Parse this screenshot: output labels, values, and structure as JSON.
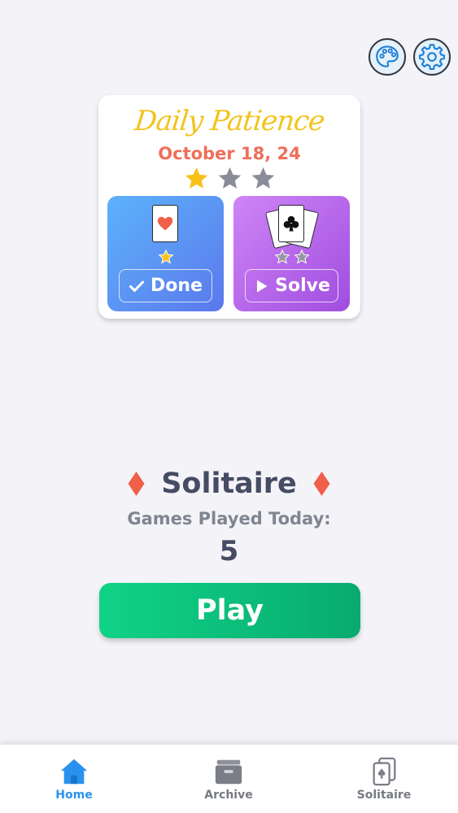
{
  "header": {
    "palette_icon": "palette-icon",
    "settings_icon": "gear-icon"
  },
  "daily": {
    "title": "Daily Patience",
    "date": "October 18, 24",
    "stars_earned": 1,
    "stars_total": 3,
    "star_color_on": "#f8c11a",
    "star_color_off": "#8a8c98",
    "cards": [
      {
        "suit": "heart",
        "suit_glyph": "♥",
        "stars_earned": 1,
        "stars_total": 1,
        "button_label": "Done",
        "button_icon": "checkmark-icon"
      },
      {
        "suit": "club",
        "suit_glyph": "♣",
        "stars_earned": 0,
        "stars_total": 2,
        "button_label": "Solve",
        "button_icon": "play-icon"
      }
    ]
  },
  "solitaire": {
    "title": "Solitaire",
    "games_label": "Games Played Today:",
    "games_count": "5",
    "play_label": "Play",
    "accent_color": "#10c17e",
    "diamond_color": "#ef5f4a"
  },
  "nav": {
    "items": [
      {
        "label": "Home",
        "icon": "house-icon",
        "active": true
      },
      {
        "label": "Archive",
        "icon": "archive-box-icon",
        "active": false
      },
      {
        "label": "Solitaire",
        "icon": "cards-icon",
        "active": false
      }
    ],
    "active_color": "#2a92ee"
  }
}
